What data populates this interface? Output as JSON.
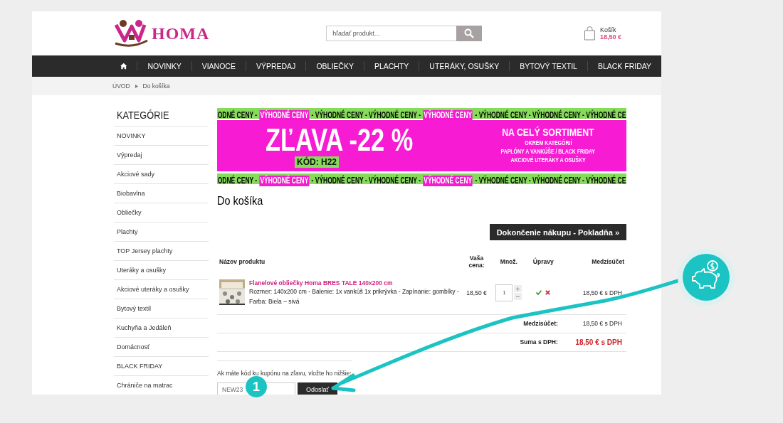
{
  "header": {
    "logo_text": "HOMA",
    "search": {
      "placeholder": "hľadať produkt..."
    },
    "cart": {
      "label": "Košík",
      "total": "18,50 €"
    }
  },
  "nav": {
    "items": [
      "NOVINKY",
      "VIANOCE",
      "VÝPREDAJ",
      "OBLIEČKY",
      "PLACHTY",
      "UTERÁKY, OSUŠKY",
      "BYTOVÝ TEXTIL",
      "BLACK FRIDAY"
    ]
  },
  "breadcrumb": [
    "ÚVOD",
    "Do košíka"
  ],
  "sidebar": {
    "title": "KATEGÓRIE",
    "items": [
      "NOVINKY",
      "Výpredaj",
      "Akciové sady",
      "Biobavlna",
      "Obliečky",
      "Plachty",
      "TOP Jersey plachty",
      "Uteráky a osušky",
      "Akciové uteráky a osušky",
      "Bytový textil",
      "Kuchyňa a Jedáleň",
      "Domácnosť",
      "BLACK FRIDAY",
      "Chrániče na matrac"
    ]
  },
  "banner": {
    "top_ticker": [
      {
        "text": "ODNÉ CENY -",
        "highlighted": false
      },
      {
        "text": "VÝHODNÉ CENY",
        "highlighted": true
      },
      {
        "text": "- VÝHODNÉ CENY - VÝHODNÉ CENY -",
        "highlighted": false
      },
      {
        "text": "VÝHODNÉ CENY",
        "highlighted": true
      },
      {
        "text": "- VÝHODNÉ CENY - VÝHODNÉ CENY - VÝHODNÉ CE",
        "highlighted": false
      }
    ],
    "headline": "ZĽAVA -22 %",
    "code": "KÓD: H22",
    "side_lines": [
      "NA CELÝ SORTIMENT",
      "OKREM KATEGÓRIÍ",
      "PAPLÓNY A VANKÚŠE / BLACK FRIDAY",
      "AKCIOVÉ UTERÁKY A OSUŠKY"
    ],
    "bottom_ticker": [
      {
        "text": "ODNÉ CENY -",
        "highlighted": false
      },
      {
        "text": "VÝHODNÉ CENY",
        "highlighted": true
      },
      {
        "text": "- VÝHODNÉ CENY - VÝHODNÉ CENY -",
        "highlighted": false
      },
      {
        "text": "VÝHODNÉ CENY",
        "highlighted": true
      },
      {
        "text": "- VÝHODNÉ CENY - VÝHODNÉ CENY - VÝHODNÉ CE",
        "highlighted": false
      }
    ]
  },
  "page_title": "Do košíka",
  "checkout_button": "Dokončenie nákupu - Pokladňa »",
  "cart_table": {
    "columns": [
      "Názov produktu",
      "Vaša cena:",
      "Množ.",
      "Úpravy",
      "Medzisúčet"
    ],
    "rows": [
      {
        "name": "Flanelové obliečky Homa BRES TALE 140x200 cm",
        "details": "Rozmer: 140x200 cm - Balenie: 1x vankúš 1x prikrývka - Zapínanie: gombíky - Farba: Biela – sivá",
        "price": "18,50 €",
        "quantity": "1",
        "subtotal": "18,50 € s DPH"
      }
    ],
    "totals": [
      {
        "kind": "subtotal",
        "label": "Medzisúčet:",
        "value": "18,50 € s DPH"
      },
      {
        "kind": "total",
        "label": "Suma s DPH:",
        "value": "18,50 € s DPH"
      }
    ]
  },
  "coupon": {
    "prompt": "Ak máte kód ku kupónu na zľavu, vložte ho nižšie:",
    "value": "NEW23",
    "button": "Odoslať"
  },
  "annotation": {
    "step": "1"
  }
}
